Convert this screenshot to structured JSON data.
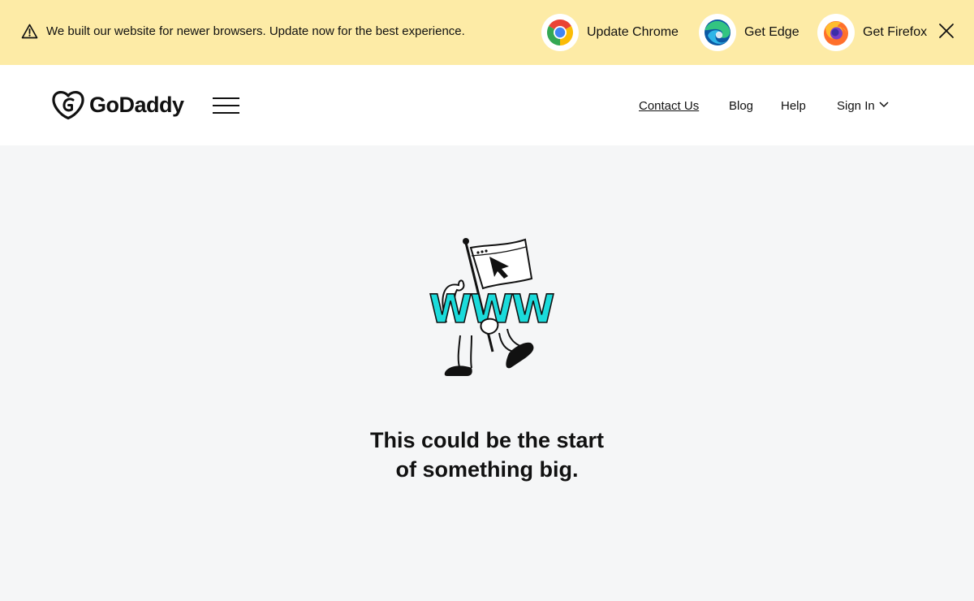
{
  "banner": {
    "message": "We built our website for newer browsers. Update now for the best experience.",
    "warning_icon": "warning-triangle-icon",
    "browsers": [
      {
        "label": "Update Chrome",
        "icon": "chrome-icon"
      },
      {
        "label": "Get Edge",
        "icon": "edge-icon"
      },
      {
        "label": "Get Firefox",
        "icon": "firefox-icon"
      }
    ],
    "close_icon": "close-icon",
    "background": "#fdeba6"
  },
  "header": {
    "brand": "GoDaddy",
    "menu_icon": "hamburger-menu-icon",
    "nav": {
      "contact": "Contact Us",
      "blog": "Blog",
      "help": "Help",
      "signin": "Sign In"
    }
  },
  "hero": {
    "illustration_text": "WWW",
    "headline": "This could be the start of something big.",
    "accent": "#1bdbdb"
  }
}
